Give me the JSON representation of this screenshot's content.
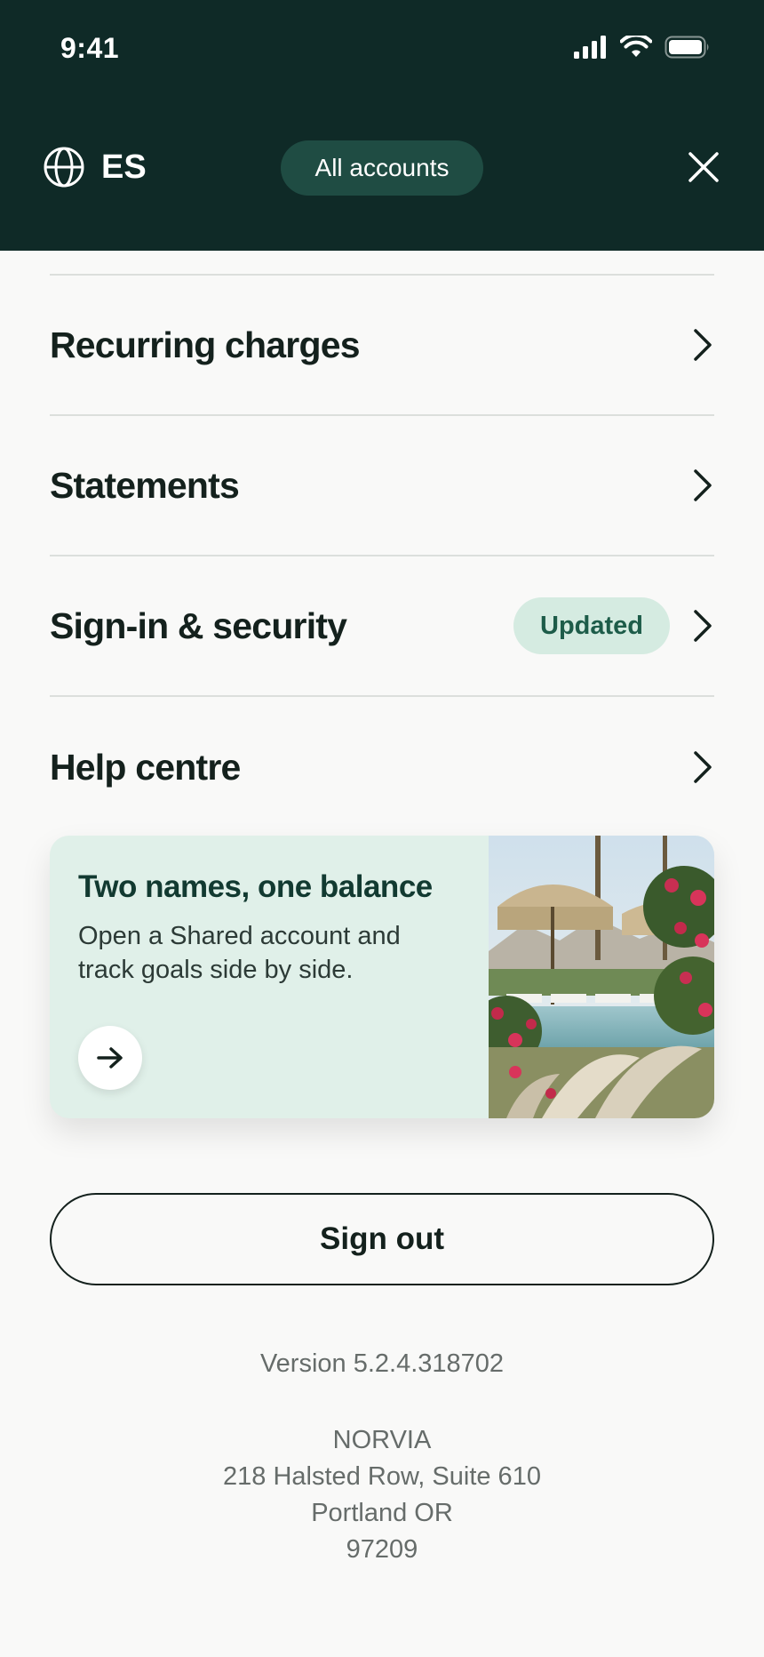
{
  "status_bar": {
    "time": "9:41",
    "icons": [
      "signal-icon",
      "wifi-icon",
      "battery-icon"
    ]
  },
  "header": {
    "language_code": "ES",
    "language_icon": "globe-icon",
    "account_selector_label": "All accounts",
    "close_icon": "close-icon"
  },
  "menu": {
    "items": [
      {
        "label": "Recurring charges",
        "badge": null
      },
      {
        "label": "Statements",
        "badge": null
      },
      {
        "label": "Sign-in & security",
        "badge": "Updated"
      },
      {
        "label": "Help centre",
        "badge": null
      }
    ]
  },
  "promo": {
    "title": "Two names, one balance",
    "body": "Open a Shared account and track goals side by side.",
    "action_icon": "arrow-right-icon"
  },
  "sign_out_label": "Sign out",
  "footer": {
    "version": "Version 5.2.4.318702",
    "address_lines": [
      "NORVIA",
      "218 Halsted Row, Suite 610",
      "Portland OR",
      "97209"
    ]
  },
  "colors": {
    "header_bg": "#0f2a27",
    "account_pill_bg": "#1f4c43",
    "badge_bg": "#d5ebe1",
    "badge_text": "#1d5c49",
    "promo_bg": "#e0f0e9",
    "page_bg": "#f9f9f8"
  }
}
